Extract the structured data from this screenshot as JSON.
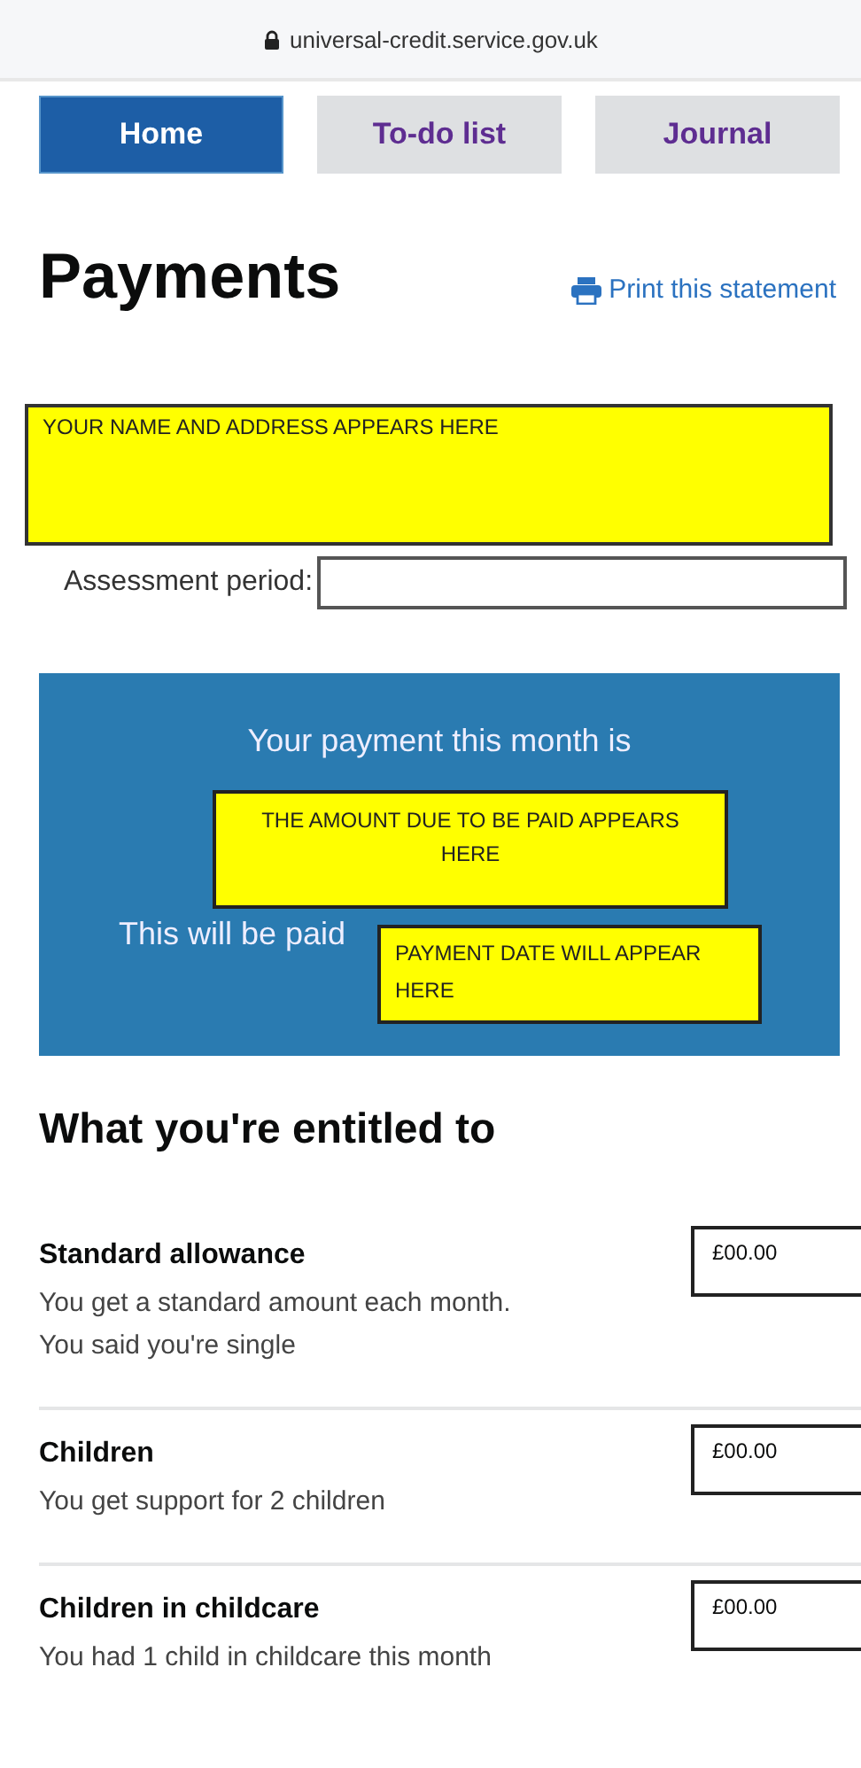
{
  "browser": {
    "url": "universal-credit.service.gov.uk"
  },
  "tabs": [
    {
      "label": "Home",
      "selected": true
    },
    {
      "label": "To-do list",
      "selected": false
    },
    {
      "label": "Journal",
      "selected": false
    }
  ],
  "heading": "Payments",
  "print_link": "Print this statement",
  "name_address": "YOUR NAME AND ADDRESS APPEARS HERE",
  "assessment_period": {
    "label": "Assessment period:"
  },
  "payment_panel": {
    "intro": "Your payment this month is",
    "amount_note": "THE AMOUNT DUE TO BE PAID APPEARS HERE",
    "paid_text": "This will be paid",
    "date_note": "PAYMENT DATE WILL APPEAR HERE"
  },
  "entitlements_heading": "What you're entitled to",
  "entitlements": [
    {
      "title": "Standard allowance",
      "lines": [
        "You get a standard amount each month.",
        "You said you're single"
      ],
      "amount": "£00.00"
    },
    {
      "title": "Children",
      "lines": [
        "You get support for 2 children"
      ],
      "amount": "£00.00"
    },
    {
      "title": "Children in childcare",
      "lines": [
        "You had 1 child in childcare this month"
      ],
      "amount": "£00.00"
    }
  ]
}
